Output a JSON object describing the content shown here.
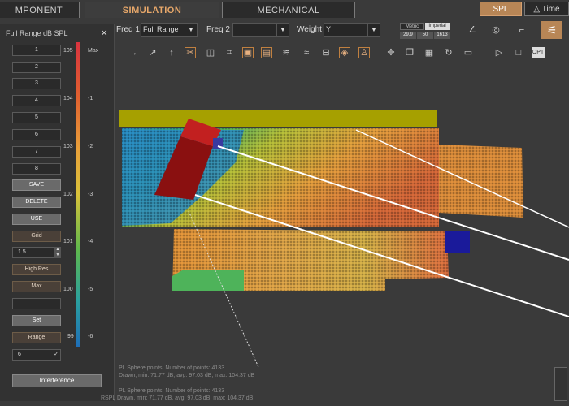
{
  "tabs": {
    "component": "MPONENT",
    "simulation": "SIMULATION",
    "mechanical": "MECHANICAL"
  },
  "top_right": {
    "spl": "SPL",
    "time": "Time"
  },
  "toolbar": {
    "freq1_label": "Freq 1",
    "freq1_value": "Full Range",
    "freq2_label": "Freq 2",
    "freq2_value": "",
    "weight_label": "Weight",
    "weight_value": "Y",
    "metric": "Metric",
    "imperial": "Imperial",
    "val1": "29.9",
    "val2": "50",
    "val3": "1613"
  },
  "panel": {
    "title": "Full Range dB SPL",
    "close": "×",
    "slots": [
      "1",
      "2",
      "3",
      "4",
      "5",
      "6",
      "7",
      "8"
    ],
    "save": "SAVE",
    "delete": "DELETE",
    "use": "USE",
    "grid": "Grid",
    "grid_value": "1.5",
    "high_res": "High Res",
    "max": "Max",
    "set": "Set",
    "range": "Range",
    "range_value": "6",
    "interference": "Interference",
    "scale_left": [
      "105",
      "104",
      "103",
      "102",
      "101",
      "100",
      "99"
    ],
    "scale_right": [
      "Max",
      "-1",
      "-2",
      "-3",
      "-4",
      "-5",
      "-6"
    ]
  },
  "status": {
    "line1": "PL Sphere points. Number of points: 4133",
    "line2": "Drawn, min: 71.77 dB, avg: 97.03 dB, max: 104.37 dB",
    "line3": "PL Sphere points. Number of points: 4133",
    "line4": "RSPL Drawn, min: 71.77 dB, avg: 97.03 dB, max: 104.37 dB"
  },
  "chart_data": {
    "type": "heatmap",
    "title": "Full Range dB SPL",
    "colorscale_db": [
      105,
      99
    ],
    "colors": [
      "#d9333f",
      "#e0602f",
      "#e8a03a",
      "#d9c23a",
      "#5fb84c",
      "#2aa0a0",
      "#1f6fb8"
    ]
  }
}
